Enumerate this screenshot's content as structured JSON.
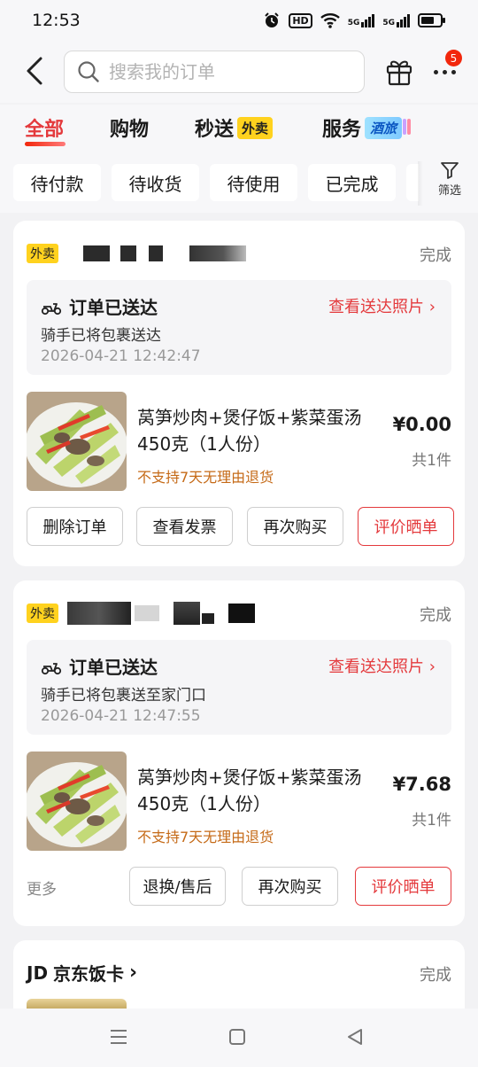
{
  "status_bar": {
    "time": "12:53",
    "icons": [
      "alarm-icon",
      "hd-icon",
      "wifi-icon",
      "signal-5g-icon",
      "signal-5g-icon",
      "battery-icon"
    ],
    "hd": "HD",
    "net1": "5G",
    "net2": "5G"
  },
  "header": {
    "search_placeholder": "搜索我的订单",
    "notification_count": "5"
  },
  "tabs": [
    {
      "label": "全部"
    },
    {
      "label": "购物"
    },
    {
      "label": "秒送",
      "tag": "外卖"
    },
    {
      "label": "服务",
      "tag": "酒旅"
    }
  ],
  "filters": {
    "chips": [
      "待付款",
      "待收货",
      "待使用",
      "已完成"
    ],
    "filter_label": "筛选"
  },
  "orders": [
    {
      "badge": "外卖",
      "status": "完成",
      "delivery_title": "订单已送达",
      "delivery_link": "查看送达照片",
      "delivery_desc": "骑手已将包裹送达",
      "delivery_time": "2026-04-21 12:42:47",
      "product_name": "莴笋炒肉+煲仔饭+紫菜蛋汤450克（1人份）",
      "product_note": "不支持7天无理由退货",
      "price": "¥0.00",
      "qty": "共1件",
      "actions": [
        "删除订单",
        "查看发票",
        "再次购买",
        "评价晒单"
      ]
    },
    {
      "badge": "外卖",
      "status": "完成",
      "delivery_title": "订单已送达",
      "delivery_link": "查看送达照片",
      "delivery_desc": "骑手已将包裹送至家门口",
      "delivery_time": "2026-04-21 12:47:55",
      "product_name": "莴笋炒肉+煲仔饭+紫菜蛋汤450克（1人份）",
      "product_note": "不支持7天无理由退货",
      "price": "¥7.68",
      "qty": "共1件",
      "more": "更多",
      "actions": [
        "退换/售后",
        "再次购买",
        "评价晒单"
      ]
    },
    {
      "brand": "JD",
      "title": "京东饭卡",
      "status": "完成"
    }
  ],
  "colors": {
    "accent": "#e4393c",
    "waimai_tag": "#ffd21e",
    "note": "#c56a17"
  }
}
